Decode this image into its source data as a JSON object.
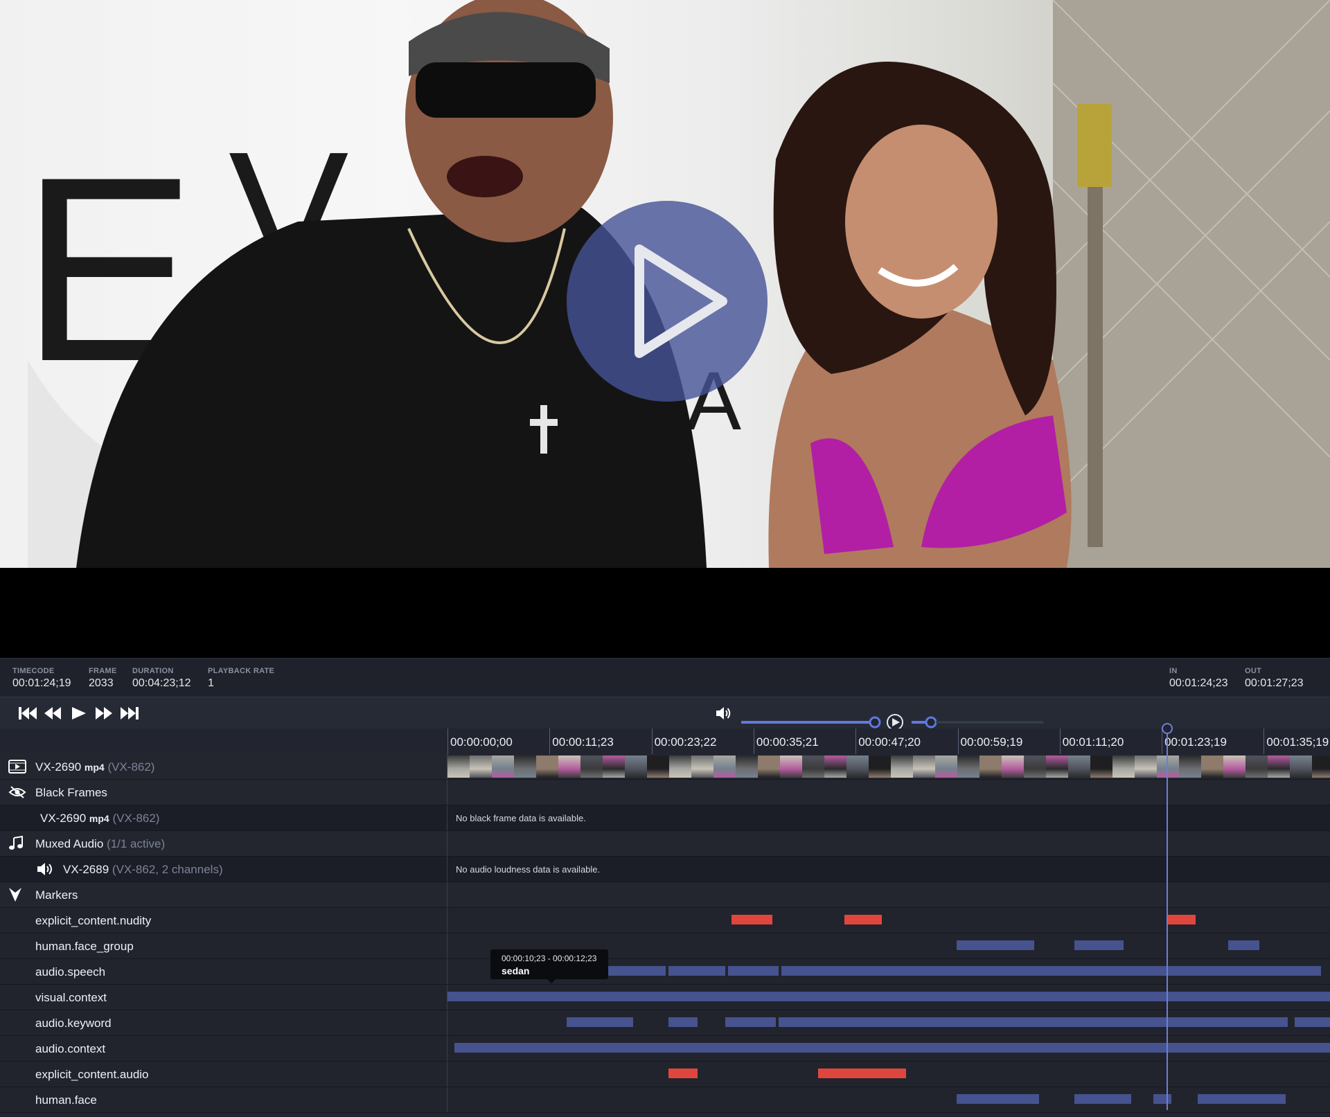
{
  "video": {
    "play_button": "play-icon"
  },
  "info": {
    "timecode": {
      "label": "TIMECODE",
      "value": "00:01:24;19"
    },
    "frame": {
      "label": "FRAME",
      "value": "2033"
    },
    "duration": {
      "label": "DURATION",
      "value": "00:04:23;12"
    },
    "playback_rate": {
      "label": "PLAYBACK RATE",
      "value": "1"
    },
    "in": {
      "label": "IN",
      "value": "00:01:24;23"
    },
    "out": {
      "label": "OUT",
      "value": "00:01:27;23"
    }
  },
  "volume": {
    "level": 0.9
  },
  "ruler": {
    "ticks": [
      "00:00:00;00",
      "00:00:11;23",
      "00:00:23;22",
      "00:00:35;21",
      "00:00:47;20",
      "00:00:59;19",
      "00:01:11;20",
      "00:01:23;19",
      "00:01:35;19"
    ]
  },
  "tracks": {
    "video": {
      "id": "VX-2690",
      "format": "mp4",
      "ref": "(VX-862)"
    },
    "black_frames": {
      "title": "Black Frames",
      "item_id": "VX-2690",
      "item_format": "mp4",
      "item_ref": "(VX-862)",
      "message": "No black frame data is available."
    },
    "audio": {
      "title": "Muxed Audio",
      "active": "(1/1 active)",
      "item_id": "VX-2689",
      "item_ref": "(VX-862, 2 channels)",
      "message": "No audio loudness data is available."
    },
    "markers": {
      "title": "Markers"
    }
  },
  "marker_rows": [
    {
      "name": "explicit_content.nudity",
      "color": "#e0463e",
      "segments": [
        [
          0.322,
          0.345
        ],
        [
          0.345,
          0.368
        ],
        [
          0.45,
          0.492
        ],
        [
          0.815,
          0.848
        ]
      ]
    },
    {
      "name": "human.face_group",
      "color": "#46538f",
      "segments": [
        [
          0.577,
          0.665
        ],
        [
          0.71,
          0.766
        ],
        [
          0.885,
          0.92
        ]
      ]
    },
    {
      "name": "audio.speech",
      "color": "#46538f",
      "segments": [
        [
          0.135,
          0.247
        ],
        [
          0.25,
          0.315
        ],
        [
          0.318,
          0.375
        ],
        [
          0.378,
          0.99
        ]
      ]
    },
    {
      "name": "visual.context",
      "color": "#46538f",
      "segments": [
        [
          0.0,
          1.0
        ]
      ]
    },
    {
      "name": "audio.keyword",
      "color": "#46538f",
      "segments": [
        [
          0.135,
          0.21
        ],
        [
          0.25,
          0.283
        ],
        [
          0.315,
          0.372
        ],
        [
          0.375,
          0.952
        ],
        [
          0.96,
          1.0
        ]
      ]
    },
    {
      "name": "audio.context",
      "color": "#46538f",
      "segments": [
        [
          0.008,
          1.0
        ]
      ]
    },
    {
      "name": "explicit_content.audio",
      "color": "#e0463e",
      "segments": [
        [
          0.25,
          0.283
        ],
        [
          0.42,
          0.52
        ]
      ]
    },
    {
      "name": "human.face",
      "color": "#46538f",
      "segments": [
        [
          0.577,
          0.67
        ],
        [
          0.71,
          0.775
        ],
        [
          0.8,
          0.82
        ],
        [
          0.85,
          0.95
        ]
      ]
    }
  ],
  "tooltip": {
    "range": "00:00:10;23 - 00:00:12;23",
    "label": "sedan"
  }
}
